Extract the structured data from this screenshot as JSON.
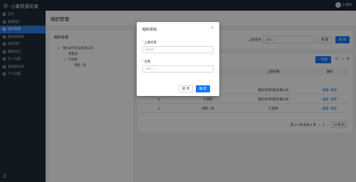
{
  "app": {
    "title": "小果莉通讯录",
    "user_name": "小果莉"
  },
  "sidebar": {
    "items": [
      {
        "label": "主页",
        "active": false
      },
      {
        "label": "管理用户",
        "active": false
      },
      {
        "label": "组织管理",
        "active": true
      },
      {
        "label": "通讯录管理",
        "active": false
      },
      {
        "label": "组织用户",
        "active": false
      },
      {
        "label": "数据导出",
        "active": false
      },
      {
        "label": "导入设置",
        "active": false
      },
      {
        "label": "发送通讯录",
        "active": false
      },
      {
        "label": "个人设置",
        "active": false
      }
    ],
    "collapse_icon": "menu-icon"
  },
  "page": {
    "title": "组织管理"
  },
  "tree": {
    "title": "组织管理",
    "nodes": [
      {
        "label": "重庆本可科技有限公司",
        "level": 0,
        "caret": "▾"
      },
      {
        "label": "销售部",
        "level": 1,
        "caret": ""
      },
      {
        "label": "行政部",
        "level": 1,
        "caret": "▾"
      },
      {
        "label": "销售一部",
        "level": 2,
        "caret": ""
      }
    ]
  },
  "search": {
    "label": "上级名称",
    "placeholder": "请输入",
    "reset_label": "重 置",
    "search_label": "查 询"
  },
  "table": {
    "add_label": "+ 新建",
    "columns": [
      "",
      "名称",
      "上级名称",
      "操作"
    ],
    "rows": [
      {
        "index": "",
        "name": "",
        "parent": "重庆本可科技有限公司",
        "ops": [
          "编辑",
          "删除"
        ]
      },
      {
        "index": "3",
        "name": "行政部",
        "parent": "重庆本可科技有限公司",
        "ops": [
          "编辑",
          "删除"
        ]
      },
      {
        "index": "4",
        "name": "销售一部",
        "parent": "行政部",
        "ops": [
          "编辑",
          "删除"
        ]
      }
    ],
    "pagination": {
      "summary": "第 1-4 条/总共 4 条",
      "prev": "‹",
      "current": "1",
      "next": "›",
      "page_size": "10 条/页"
    }
  },
  "modal": {
    "title": "组织添加",
    "close": "×",
    "fields": [
      {
        "label": "上级名称",
        "required": true,
        "placeholder": "请选择",
        "type": "select"
      },
      {
        "label": "名称",
        "required": true,
        "placeholder": "请输入",
        "type": "text"
      }
    ],
    "cancel_label": "取 消",
    "ok_label": "确 定"
  }
}
